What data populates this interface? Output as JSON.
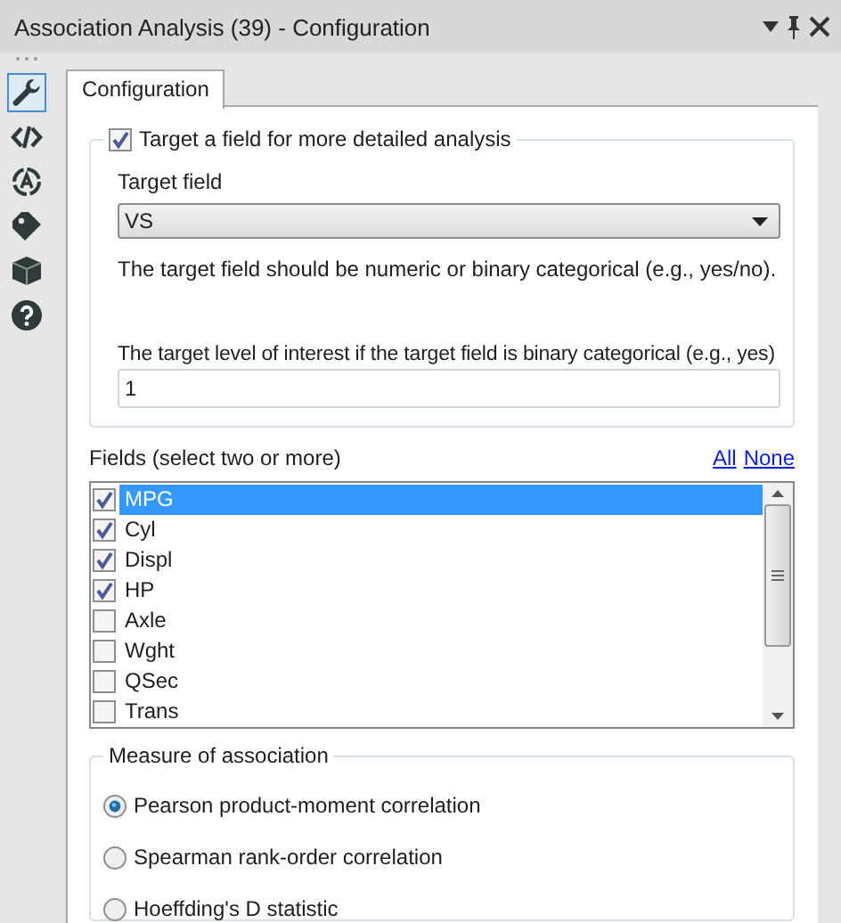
{
  "window": {
    "title": "Association Analysis (39) - Configuration"
  },
  "sidebar": {
    "items": [
      {
        "kind": "wrench",
        "selected": true
      },
      {
        "kind": "code",
        "selected": false
      },
      {
        "kind": "target",
        "selected": false
      },
      {
        "kind": "tag",
        "selected": false
      },
      {
        "kind": "box",
        "selected": false
      },
      {
        "kind": "help",
        "selected": false
      }
    ]
  },
  "tabs": [
    {
      "label": "Configuration",
      "selected": true
    }
  ],
  "target_group": {
    "label": "Target a field for more detailed analysis",
    "checked": true,
    "target_field": {
      "label": "Target field",
      "value": "VS"
    },
    "hint": "The target field should be numeric or binary categorical (e.g., yes/no).",
    "level": {
      "label": "The target level of interest if the target field is binary categorical (e.g., yes)",
      "value": "1"
    }
  },
  "fields": {
    "label": "Fields (select two or more)",
    "links": [
      "All",
      "None"
    ],
    "items": [
      {
        "name": "MPG",
        "checked": true,
        "selected": true
      },
      {
        "name": "Cyl",
        "checked": true,
        "selected": false
      },
      {
        "name": "Displ",
        "checked": true,
        "selected": false
      },
      {
        "name": "HP",
        "checked": true,
        "selected": false
      },
      {
        "name": "Axle",
        "checked": false,
        "selected": false
      },
      {
        "name": "Wght",
        "checked": false,
        "selected": false
      },
      {
        "name": "QSec",
        "checked": false,
        "selected": false
      },
      {
        "name": "Trans",
        "checked": false,
        "selected": false
      }
    ]
  },
  "measure": {
    "label": "Measure of association",
    "options": [
      {
        "label": "Pearson product-moment correlation",
        "selected": true
      },
      {
        "label": "Spearman rank-order correlation",
        "selected": false
      },
      {
        "label": "Hoeffding's D statistic",
        "selected": false
      }
    ]
  }
}
